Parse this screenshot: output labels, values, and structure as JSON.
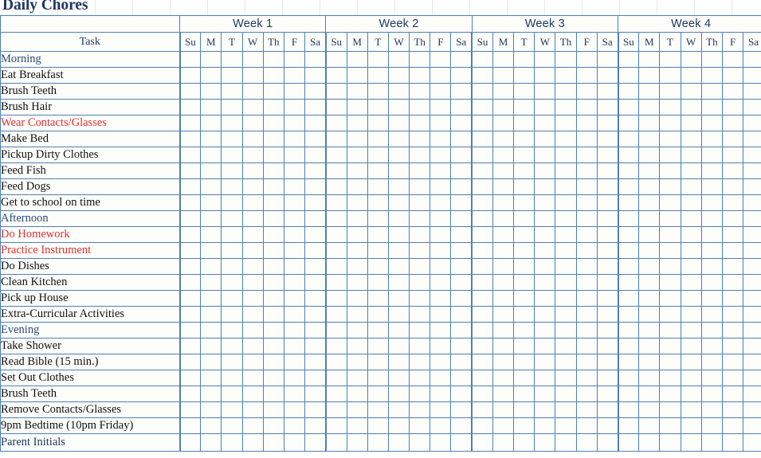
{
  "title": "Daily Chores",
  "table": {
    "task_column_header": "Task",
    "weeks": [
      {
        "label": "Week 1",
        "days": [
          "Su",
          "M",
          "T",
          "W",
          "Th",
          "F",
          "Sa"
        ]
      },
      {
        "label": "Week 2",
        "days": [
          "Su",
          "M",
          "T",
          "W",
          "Th",
          "F",
          "Sa"
        ]
      },
      {
        "label": "Week 3",
        "days": [
          "Su",
          "M",
          "T",
          "W",
          "Th",
          "F",
          "Sa"
        ]
      },
      {
        "label": "Week 4",
        "days": [
          "Su",
          "M",
          "T",
          "W",
          "Th",
          "F",
          "Sa"
        ]
      }
    ],
    "sections": [
      {
        "label": "Morning",
        "tasks": [
          {
            "label": "Eat Breakfast",
            "highlight": false
          },
          {
            "label": "Brush Teeth",
            "highlight": false
          },
          {
            "label": "Brush Hair",
            "highlight": false
          },
          {
            "label": "Wear Contacts/Glasses",
            "highlight": true
          },
          {
            "label": "Make Bed",
            "highlight": false
          },
          {
            "label": "Pickup Dirty Clothes",
            "highlight": false
          },
          {
            "label": "Feed Fish",
            "highlight": false
          },
          {
            "label": "Feed Dogs",
            "highlight": false
          },
          {
            "label": "Get to school on time",
            "highlight": false
          }
        ]
      },
      {
        "label": "Afternoon",
        "tasks": [
          {
            "label": "Do Homework",
            "highlight": true
          },
          {
            "label": "Practice Instrument",
            "highlight": true
          },
          {
            "label": "Do Dishes",
            "highlight": false
          },
          {
            "label": "Clean Kitchen",
            "highlight": false
          },
          {
            "label": "Pick up House",
            "highlight": false
          },
          {
            "label": "Extra-Curricular Activities",
            "highlight": false
          }
        ]
      },
      {
        "label": "Evening",
        "tasks": [
          {
            "label": "Take Shower",
            "highlight": false
          },
          {
            "label": "Read Bible (15 min.)",
            "highlight": false
          },
          {
            "label": "Set Out Clothes",
            "highlight": false
          },
          {
            "label": "Brush Teeth",
            "highlight": false
          },
          {
            "label": "Remove Contacts/Glasses",
            "highlight": false
          },
          {
            "label": "9pm Bedtime (10pm Friday)",
            "highlight": false
          }
        ]
      }
    ],
    "footer_label": "Parent Initials"
  },
  "colors": {
    "header_text": "#1f3864",
    "section_fill": "#c5d7ee",
    "section_text": "#2a4d75",
    "grid_border": "#4e81b4",
    "cell_border": "#6a93bf",
    "highlight_text": "#e03131",
    "cell_background": "#fdfdfa"
  }
}
